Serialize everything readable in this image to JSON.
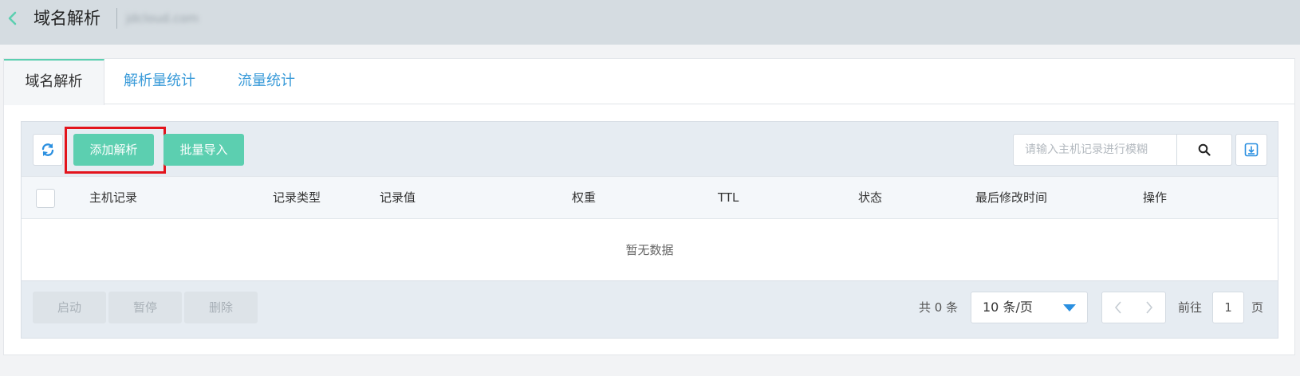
{
  "header": {
    "title": "域名解析",
    "domain": "jdcloud.com"
  },
  "tabs": [
    {
      "label": "域名解析",
      "active": true
    },
    {
      "label": "解析量统计",
      "active": false
    },
    {
      "label": "流量统计",
      "active": false
    }
  ],
  "toolbar": {
    "add_label": "添加解析",
    "import_label": "批量导入",
    "search_placeholder": "请输入主机记录进行模糊"
  },
  "table": {
    "columns": [
      "主机记录",
      "记录类型",
      "记录值",
      "权重",
      "TTL",
      "状态",
      "最后修改时间",
      "操作"
    ],
    "empty_text": "暂无数据",
    "rows": []
  },
  "footer": {
    "enable_label": "启动",
    "pause_label": "暂停",
    "delete_label": "删除",
    "total_text": "共 0 条",
    "page_size": "10 条/页",
    "goto_label": "前往",
    "current_page": "1",
    "page_unit": "页"
  },
  "colors": {
    "accent": "#5ccfb0",
    "link": "#3a9bd9",
    "highlight": "#e3141c"
  },
  "icons": {
    "back": "chevron-left-icon",
    "refresh": "refresh-icon",
    "search": "search-icon",
    "export": "download-icon",
    "prev": "chevron-left-icon",
    "next": "chevron-right-icon",
    "dropdown": "caret-down-icon"
  }
}
